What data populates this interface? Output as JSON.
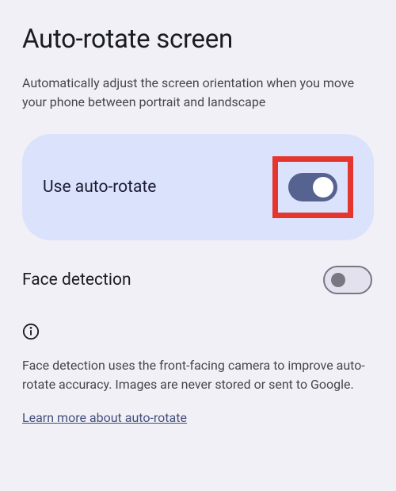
{
  "pageTitle": "Auto-rotate screen",
  "description": "Automatically adjust the screen orientation when you move your phone between portrait and landscape",
  "autoRotate": {
    "label": "Use auto-rotate",
    "enabled": true
  },
  "faceDetection": {
    "label": "Face detection",
    "enabled": false
  },
  "infoText": "Face detection uses the front-facing camera to improve auto-rotate accuracy. Images are never stored or sent to Google.",
  "learnMoreLabel": "Learn more about auto-rotate"
}
